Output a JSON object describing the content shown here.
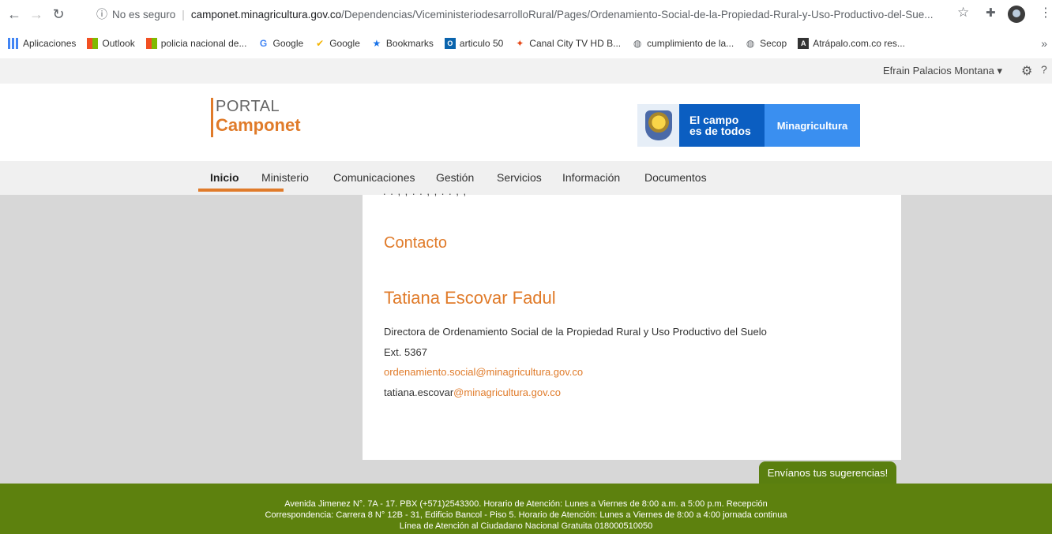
{
  "browser": {
    "insecure_label": "No es seguro",
    "url_host": "camponet.minagricultura.gov.co",
    "url_path": "/Dependencias/ViceministeriodesarrolloRural/Pages/Ordenamiento-Social-de-la-Propiedad-Rural-y-Uso-Productivo-del-Sue...",
    "bookmarks": [
      {
        "label": "Aplicaciones",
        "icon": "apps-icon"
      },
      {
        "label": "Outlook",
        "icon": "microsoft-icon"
      },
      {
        "label": "policia nacional de...",
        "icon": "microsoft-icon"
      },
      {
        "label": "Google",
        "icon": "google-icon"
      },
      {
        "label": "Google",
        "icon": "check-icon"
      },
      {
        "label": "Bookmarks",
        "icon": "star-icon"
      },
      {
        "label": "articulo 50",
        "icon": "outlook-icon"
      },
      {
        "label": "Canal City TV HD B...",
        "icon": "canal-icon"
      },
      {
        "label": "cumplimiento de la...",
        "icon": "globe-icon"
      },
      {
        "label": "Secop",
        "icon": "globe-icon"
      },
      {
        "label": "Atrápalo.com.co res...",
        "icon": "atrapalo-icon"
      }
    ],
    "bookmarks_more": "»"
  },
  "site": {
    "user_name": "Efrain Palacios Montana ▾",
    "logo_line1": "PORTAL",
    "logo_line2": "Camponet",
    "gov_campo_line1": "El campo",
    "gov_campo_line2": "es de todos",
    "gov_min": "Minagricultura",
    "nav": [
      "Inicio",
      "Ministerio",
      "Comunicaciones",
      "Gestión",
      "Servicios",
      "Información",
      "Documentos"
    ]
  },
  "content": {
    "section_title": "Contacto",
    "person_name": "Tatiana Escovar Fadul",
    "role": "Directora de Ordenamiento Social de la Propiedad Rural y Uso Productivo del  Suelo",
    "ext": "Ext. 5367",
    "email1": "ordenamiento.social@minagricultura.gov.co",
    "email2_user": "tatiana.escovar",
    "email2_domain": "@minagricultura.gov.co"
  },
  "suggestions_button": "Envíanos tus sugerencias!",
  "footer": {
    "line1": "Avenida Jimenez N°. 7A - 17. PBX (+571)2543300. Horario de Atención: Lunes a Viernes de 8:00 a.m. a 5:00 p.m. Recepción",
    "line2": "Correspondencia: Carrera 8 N° 12B - 31, Edificio Bancol - Piso 5. Horario de Atención: Lunes a Viernes de 8:00 a 4:00 jornada continua",
    "line3": "Línea de Atención al Ciudadano Nacional Gratuita 018000510050"
  }
}
